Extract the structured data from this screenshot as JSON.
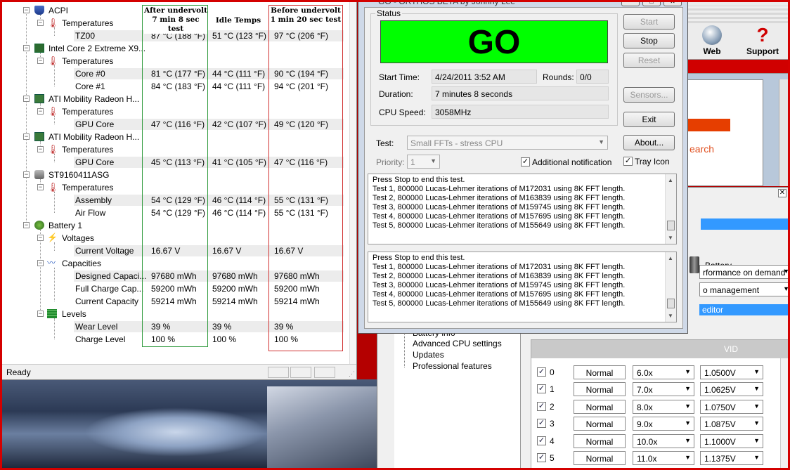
{
  "everest": {
    "status": "Ready",
    "columns": {
      "after": [
        "After undervolt",
        "7 min 8 sec test"
      ],
      "idle": "Idle Temps",
      "before": [
        "Before undervolt",
        "1 min 20 sec test"
      ]
    },
    "tree": {
      "acpi": "ACPI",
      "acpi_temps": "Temperatures",
      "tz00": {
        "label": "TZ00",
        "after": "87 °C  (188 °F)",
        "idle": "51 °C  (123 °F)",
        "before": "97 °C  (206 °F)"
      },
      "cpu": "Intel Core 2 Extreme X9...",
      "cpu_temps": "Temperatures",
      "core0": {
        "label": "Core #0",
        "after": "81 °C  (177 °F)",
        "idle": "44 °C  (111 °F)",
        "before": "90 °C  (194 °F)"
      },
      "core1": {
        "label": "Core #1",
        "after": "84 °C  (183 °F)",
        "idle": "44 °C  (111 °F)",
        "before": "94 °C  (201 °F)"
      },
      "gpu1": "ATI Mobility Radeon H...",
      "gpu1_temps": "Temperatures",
      "gpu1_core": {
        "label": "GPU Core",
        "after": "47 °C  (116 °F)",
        "idle": "42 °C  (107 °F)",
        "before": "49 °C  (120 °F)"
      },
      "gpu2": "ATI Mobility Radeon H...",
      "gpu2_temps": "Temperatures",
      "gpu2_core": {
        "label": "GPU Core",
        "after": "45 °C  (113 °F)",
        "idle": "41 °C  (105 °F)",
        "before": "47 °C  (116 °F)"
      },
      "hdd": "ST9160411ASG",
      "hdd_temps": "Temperatures",
      "assembly": {
        "label": "Assembly",
        "after": "54 °C  (129 °F)",
        "idle": "46 °C  (114 °F)",
        "before": "55 °C  (131 °F)"
      },
      "airflow": {
        "label": "Air Flow",
        "after": "54 °C  (129 °F)",
        "idle": "46 °C  (114 °F)",
        "before": "55 °C  (131 °F)"
      },
      "battery": "Battery 1",
      "voltages": "Voltages",
      "cur_voltage": {
        "label": "Current Voltage",
        "after": "16.67 V",
        "idle": "16.67 V",
        "before": "16.67 V"
      },
      "capacities": "Capacities",
      "designed": {
        "label": "Designed Capaci...",
        "after": "97680 mWh",
        "idle": "97680 mWh",
        "before": "97680 mWh"
      },
      "fullcharge": {
        "label": "Full Charge Cap...",
        "after": "59200 mWh",
        "idle": "59200 mWh",
        "before": "59200 mWh"
      },
      "curcap": {
        "label": "Current Capacity",
        "after": "59214 mWh",
        "idle": "59214 mWh",
        "before": "59214 mWh"
      },
      "levels": "Levels",
      "wear": {
        "label": "Wear Level",
        "after": "39 %",
        "idle": "39 %",
        "before": "39 %"
      },
      "charge": {
        "label": "Charge Level",
        "after": "100 %",
        "idle": "100 %",
        "before": "100 %"
      }
    }
  },
  "orthos": {
    "title": "GO - ORTHOS BETA by Johnny Lee",
    "status_label": "Status",
    "go_text": "GO",
    "start_time_label": "Start Time:",
    "start_time": "4/24/2011 3:52 AM",
    "rounds_label": "Rounds:",
    "rounds": "0/0",
    "duration_label": "Duration:",
    "duration": "7 minutes 8 seconds",
    "cpu_speed_label": "CPU Speed:",
    "cpu_speed": "3058MHz",
    "test_label": "Test:",
    "test_value": "Small FFTs - stress CPU",
    "priority_label": "Priority:",
    "priority_value": "1",
    "additional_notification": "Additional notification",
    "tray_icon": "Tray Icon",
    "buttons": {
      "start": "Start",
      "stop": "Stop",
      "reset": "Reset",
      "sensors": "Sensors...",
      "exit": "Exit",
      "about": "About..."
    },
    "log1": [
      "Press Stop to end this test.",
      "Test 1, 800000 Lucas-Lehmer iterations of M172031 using 8K FFT length.",
      "Test 2, 800000 Lucas-Lehmer iterations of M163839 using 8K FFT length.",
      "Test 3, 800000 Lucas-Lehmer iterations of M159745 using 8K FFT length.",
      "Test 4, 800000 Lucas-Lehmer iterations of M157695 using 8K FFT length.",
      "Test 5, 800000 Lucas-Lehmer iterations of M155649 using 8K FFT length."
    ],
    "log2": [
      "Press Stop to end this test.",
      "Test 1, 800000 Lucas-Lehmer iterations of M172031 using 8K FFT length.",
      "Test 2, 800000 Lucas-Lehmer iterations of M163839 using 8K FFT length.",
      "Test 3, 800000 Lucas-Lehmer iterations of M159745 using 8K FFT length.",
      "Test 4, 800000 Lucas-Lehmer iterations of M157695 using 8K FFT length.",
      "Test 5, 800000 Lucas-Lehmer iterations of M155649 using 8K FFT length."
    ]
  },
  "background_app": {
    "web": "Web",
    "support": "Support",
    "search_fragment": "earch"
  },
  "rmclock": {
    "tree": [
      "Battery info",
      "Advanced CPU settings",
      "Updates",
      "Professional features"
    ],
    "battery_label": "Battery",
    "combo1": "rformance on demand",
    "combo2": "o management",
    "editor": "editor",
    "vid_header": "VID",
    "rows": [
      {
        "idx": "0",
        "state": "Normal",
        "fid": "6.0x",
        "vid": "1.0500V"
      },
      {
        "idx": "1",
        "state": "Normal",
        "fid": "7.0x",
        "vid": "1.0625V"
      },
      {
        "idx": "2",
        "state": "Normal",
        "fid": "8.0x",
        "vid": "1.0750V"
      },
      {
        "idx": "3",
        "state": "Normal",
        "fid": "9.0x",
        "vid": "1.0875V"
      },
      {
        "idx": "4",
        "state": "Normal",
        "fid": "10.0x",
        "vid": "1.1000V"
      },
      {
        "idx": "5",
        "state": "Normal",
        "fid": "11.0x",
        "vid": "1.1375V"
      }
    ]
  },
  "colors": {
    "go_green": "#00ff00",
    "after_border": "#2f9a3c",
    "before_border": "#d03030",
    "desktop_red": "#d40000"
  }
}
